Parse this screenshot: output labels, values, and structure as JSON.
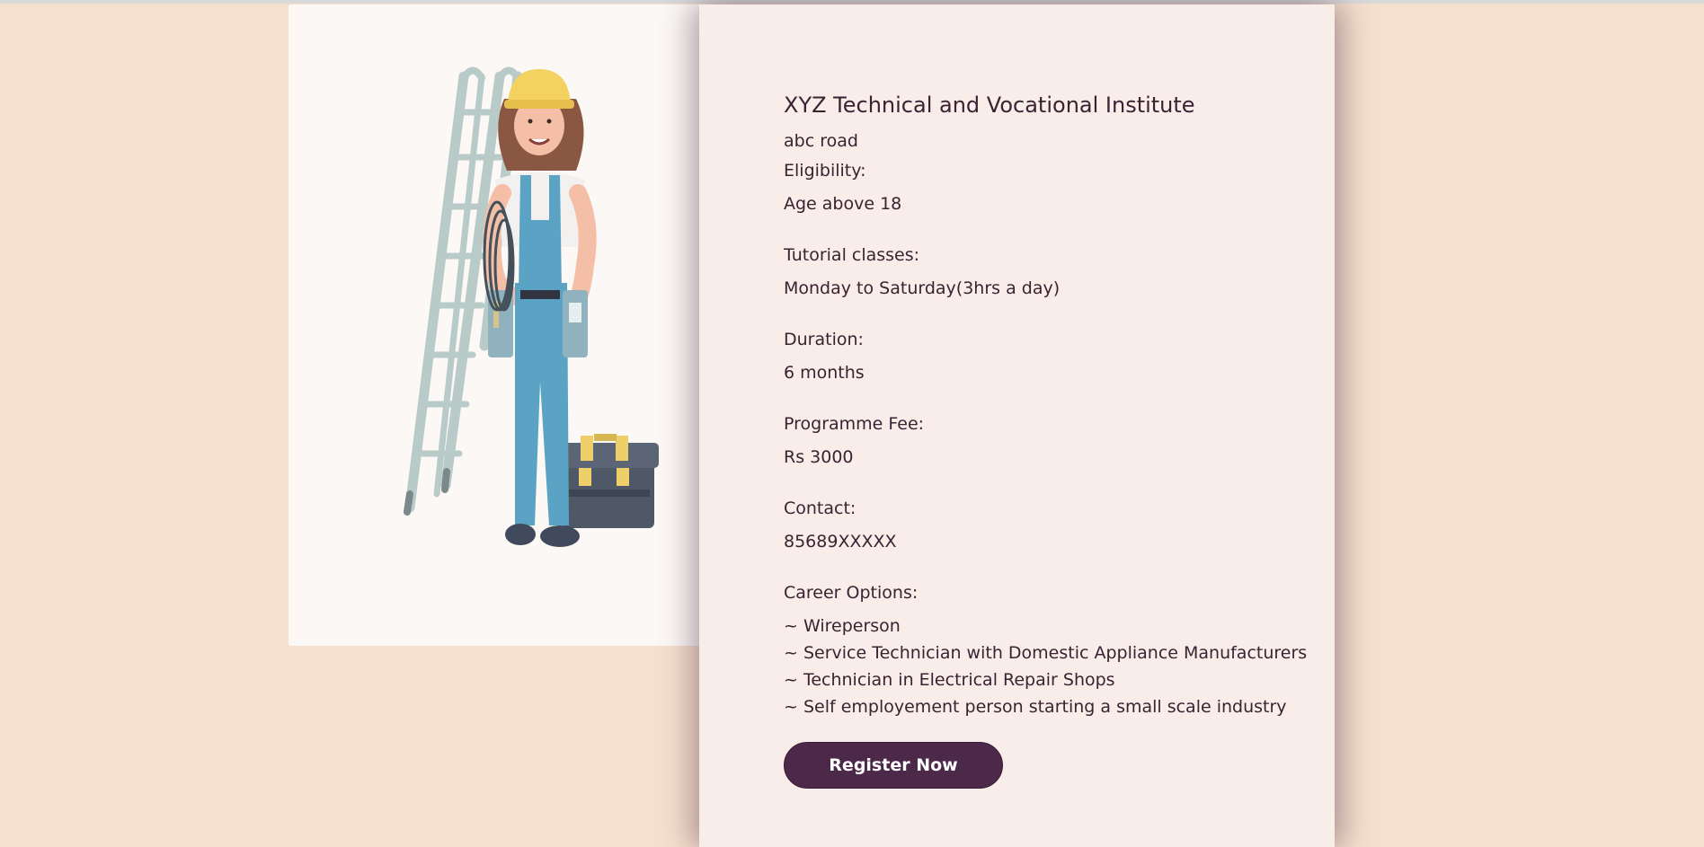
{
  "illustration": {
    "alt": "Female electrician worker with ladder and toolbox"
  },
  "course": {
    "institute_name": "XYZ Technical and Vocational Institute",
    "address": "abc road",
    "eligibility_label": "Eligibility:",
    "eligibility_value": "Age above 18",
    "tutorial_label": "Tutorial classes:",
    "tutorial_value": "Monday to Saturday(3hrs a day)",
    "duration_label": "Duration:",
    "duration_value": "6 months",
    "fee_label": "Programme Fee:",
    "fee_value": "Rs 3000",
    "contact_label": "Contact:",
    "contact_value": "85689XXXXX",
    "career_label": "Career Options:",
    "career_options": [
      "~ Wireperson",
      "~ Service Technician with Domestic Appliance Manufacturers",
      "~ Technician in Electrical Repair Shops",
      "~ Self employement person starting a small scale industry"
    ],
    "register_label": "Register Now"
  },
  "colors": {
    "page_background": "#f5dfcd",
    "card_background": "#f8ede8",
    "button_background": "#4c2849",
    "text": "#3b2233"
  }
}
